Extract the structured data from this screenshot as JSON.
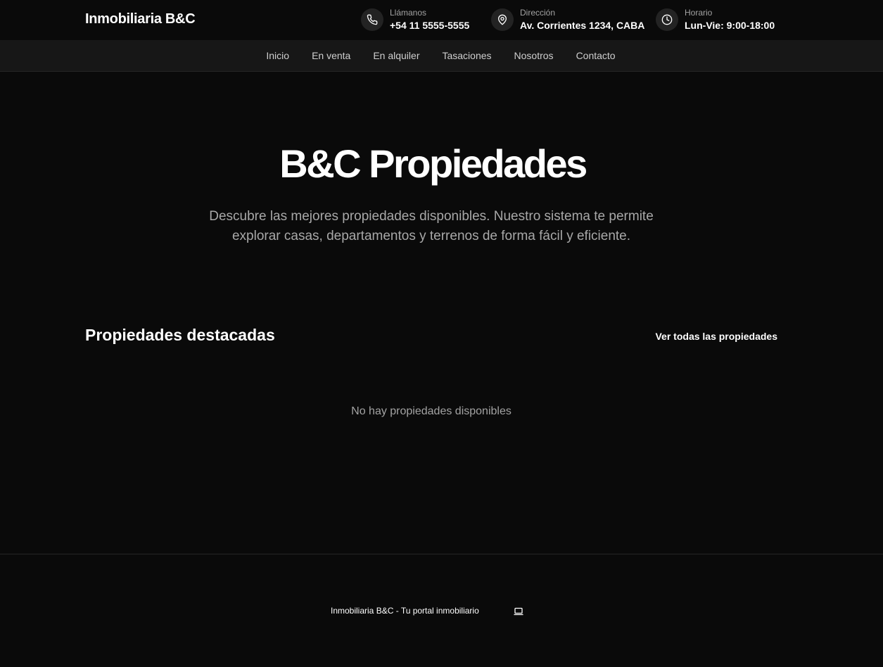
{
  "header": {
    "brand": "Inmobiliaria B&C",
    "contacts": [
      {
        "label": "Llámanos",
        "value": "+54 11 5555-5555",
        "icon": "phone-icon"
      },
      {
        "label": "Dirección",
        "value": "Av. Corrientes 1234, CABA",
        "icon": "map-pin-icon"
      },
      {
        "label": "Horario",
        "value": "Lun-Vie: 9:00-18:00",
        "icon": "clock-icon"
      }
    ]
  },
  "nav": {
    "items": [
      "Inicio",
      "En venta",
      "En alquiler",
      "Tasaciones",
      "Nosotros",
      "Contacto"
    ]
  },
  "hero": {
    "title": "B&C Propiedades",
    "subtitle": "Descubre las mejores propiedades disponibles. Nuestro sistema te permite explorar casas, departamentos y terrenos de forma fácil y eficiente."
  },
  "featured": {
    "title": "Propiedades destacadas",
    "see_all": "Ver todas las propiedades",
    "empty_message": "No hay propiedades disponibles"
  },
  "footer": {
    "text": "Inmobiliaria B&C - Tu portal inmobiliario",
    "icon": "laptop-icon"
  },
  "colors": {
    "background": "#0a0a0a",
    "nav_background": "#171717",
    "muted_text": "#a3a3a3",
    "primary_text": "#ffffff"
  }
}
